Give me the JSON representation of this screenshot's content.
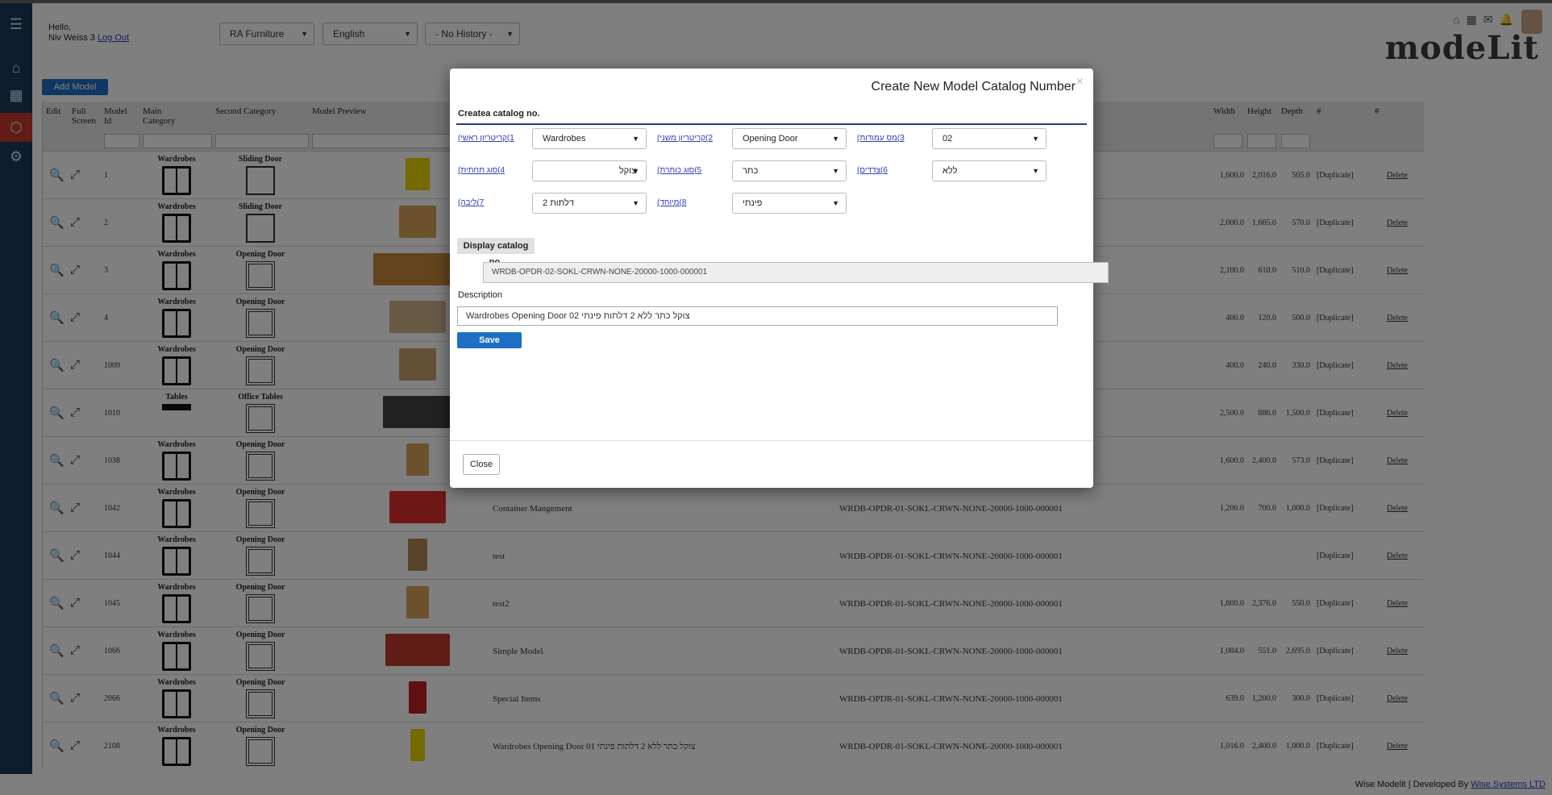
{
  "header": {
    "greeting": "Hello,",
    "user_name": "Niv Weiss 3",
    "logout": "Log Out",
    "company_select": "RA Furniture",
    "language_select": "English",
    "history_select": "- No History -",
    "logo": "modeLit"
  },
  "sidebar": {
    "items": [
      "menu-icon",
      "home-icon",
      "grid-icon",
      "cube-icon",
      "gear-icon"
    ]
  },
  "toolbar": {
    "add_model": "Add Model"
  },
  "grid": {
    "columns": [
      "Edit",
      "Full Screen",
      "Model Id",
      "Main Category",
      "Second Category",
      "Model Preview",
      "Width",
      "Height",
      "Depth",
      "#",
      "#"
    ],
    "rows": [
      {
        "id": "1",
        "main": "Wardrobes",
        "second": "Sliding Door",
        "name": "",
        "catalog": "",
        "width": "1,600.0",
        "height": "2,016.0",
        "depth": "505.0"
      },
      {
        "id": "2",
        "main": "Wardrobes",
        "second": "Sliding Door",
        "name": "",
        "catalog": "",
        "width": "2,000.0",
        "height": "1,665.0",
        "depth": "570.0"
      },
      {
        "id": "3",
        "main": "Wardrobes",
        "second": "Opening Door",
        "name": "",
        "catalog": "",
        "width": "2,100.0",
        "height": "610.0",
        "depth": "510.0"
      },
      {
        "id": "4",
        "main": "Wardrobes",
        "second": "Opening Door",
        "name": "",
        "catalog": "",
        "width": "400.0",
        "height": "120.0",
        "depth": "500.0"
      },
      {
        "id": "1009",
        "main": "Wardrobes",
        "second": "Opening Door",
        "name": "",
        "catalog": "",
        "width": "400.0",
        "height": "240.0",
        "depth": "330.0"
      },
      {
        "id": "1010",
        "main": "Tables",
        "second": "Office Tables",
        "name": "",
        "catalog": "",
        "width": "2,500.0",
        "height": "886.0",
        "depth": "1,500.0"
      },
      {
        "id": "1038",
        "main": "Wardrobes",
        "second": "Opening Door",
        "name": "",
        "catalog": "",
        "width": "1,600.0",
        "height": "2,400.0",
        "depth": "573.0"
      },
      {
        "id": "1042",
        "main": "Wardrobes",
        "second": "Opening Door",
        "name": "Container Mangement",
        "catalog": "WRDB-OPDR-01-SOKL-CRWN-NONE-20000-1000-000001",
        "width": "1,200.0",
        "height": "700.0",
        "depth": "1,000.0"
      },
      {
        "id": "1044",
        "main": "Wardrobes",
        "second": "Opening Door",
        "name": "test",
        "catalog": "WRDB-OPDR-01-SOKL-CRWN-NONE-20000-1000-000001",
        "width": "",
        "height": "",
        "depth": ""
      },
      {
        "id": "1045",
        "main": "Wardrobes",
        "second": "Opening Door",
        "name": "test2",
        "catalog": "WRDB-OPDR-01-SOKL-CRWN-NONE-20000-1000-000001",
        "width": "1,600.0",
        "height": "2,376.0",
        "depth": "550.0"
      },
      {
        "id": "1066",
        "main": "Wardrobes",
        "second": "Opening Door",
        "name": "Simple Model",
        "catalog": "WRDB-OPDR-01-SOKL-CRWN-NONE-20000-1000-000001",
        "width": "1,084.0",
        "height": "551.0",
        "depth": "2,695.0"
      },
      {
        "id": "2066",
        "main": "Wardrobes",
        "second": "Opening Door",
        "name": "Special Items",
        "catalog": "WRDB-OPDR-01-SOKL-CRWN-NONE-20000-1000-000001",
        "width": "639.0",
        "height": "1,200.0",
        "depth": "300.0"
      },
      {
        "id": "2108",
        "main": "Wardrobes",
        "second": "Opening Door",
        "name": "Wardrobes Opening Door 01 צוקל כתר ללא 2 דלתות פינתי",
        "catalog": "WRDB-OPDR-01-SOKL-CRWN-NONE-20000-1000-000001",
        "width": "1,016.0",
        "height": "2,400.0",
        "depth": "1,000.0"
      }
    ],
    "duplicate": "[Duplicate]",
    "delete": "Delete"
  },
  "modal": {
    "title": "Create New Model Catalog Number",
    "section_title": "Createa catalog no.",
    "fields": [
      {
        "label": "1)קריטריון ראשי)",
        "value": "Wardrobes"
      },
      {
        "label": "2)קריטריון משני)",
        "value": "Opening Door"
      },
      {
        "label": "3)מס עמודות)",
        "value": "02"
      },
      {
        "label": "4)סוג תחתית)",
        "value": "צוקל"
      },
      {
        "label": "5)סוג כותרת)",
        "value": "כתר"
      },
      {
        "label": "6)צדדים)",
        "value": "ללא"
      },
      {
        "label": "7)ליבה)",
        "value": "2 דלתות"
      },
      {
        "label": "8)מיוחד)",
        "value": "פינתי"
      }
    ],
    "display_button": "Display catalog no.",
    "catalog_number": "WRDB-OPDR-02-SOKL-CRWN-NONE-20000-1000-000001",
    "description_label": "Description",
    "description_value": "Wardrobes Opening Door 02 צוקל כתר ללא 2 דלתות פינתי",
    "save": "Save",
    "close": "Close"
  },
  "footer": {
    "app": "Wise Modelit",
    "developed_by": "Developed By",
    "company": "Wise Systems LTD"
  }
}
